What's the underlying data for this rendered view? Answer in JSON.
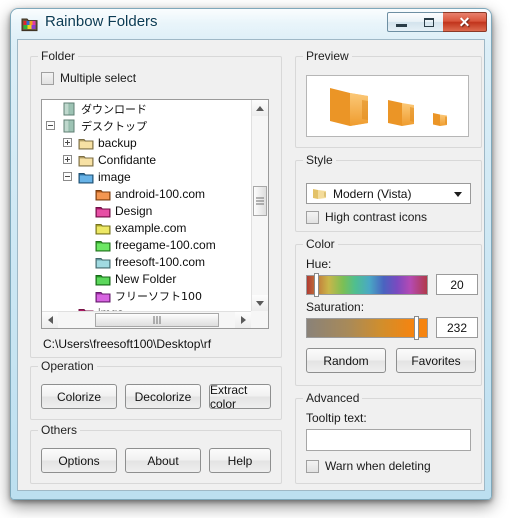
{
  "window": {
    "title": "Rainbow Folders",
    "icon": "rainbow-folder-icon",
    "minimize_label": "Minimize",
    "maximize_label": "Maximize",
    "close_label": "Close",
    "close_glyph": "✕"
  },
  "folder_group": {
    "legend": "Folder",
    "multiple_select_label": "Multiple select",
    "multiple_select_checked": false,
    "path": "C:\\Users\\freesoft100\\Desktop\\rf",
    "tree": [
      {
        "name": "ダウンロード",
        "depth": 2,
        "expander": "none",
        "icon": "special-folder-teal",
        "color": "#8fb8a8",
        "jp": true
      },
      {
        "name": "デスクトップ",
        "depth": 2,
        "expander": "minus",
        "icon": "special-folder-teal",
        "color": "#8fb8a8",
        "jp": true
      },
      {
        "name": "backup",
        "depth": 3,
        "expander": "plus",
        "icon": "folder-yellow",
        "color": "#f5d98a",
        "jp": false
      },
      {
        "name": "Confidante",
        "depth": 3,
        "expander": "plus",
        "icon": "folder-yellow",
        "color": "#f5d98a",
        "jp": false
      },
      {
        "name": "image",
        "depth": 3,
        "expander": "minus",
        "icon": "folder-blue",
        "color": "#3e9de0",
        "jp": false
      },
      {
        "name": "android-100.com",
        "depth": 4,
        "expander": "none",
        "icon": "folder-orange",
        "color": "#f07820",
        "jp": false
      },
      {
        "name": "Design",
        "depth": 4,
        "expander": "none",
        "icon": "folder-magenta",
        "color": "#e01f8b",
        "jp": false
      },
      {
        "name": "example.com",
        "depth": 4,
        "expander": "none",
        "icon": "folder-yellow-bright",
        "color": "#e8e23a",
        "jp": false
      },
      {
        "name": "freegame-100.com",
        "depth": 4,
        "expander": "none",
        "icon": "folder-green-bright",
        "color": "#44e038",
        "jp": false
      },
      {
        "name": "freesoft-100.com",
        "depth": 4,
        "expander": "none",
        "icon": "folder-cyan",
        "color": "#87cfd8",
        "jp": false
      },
      {
        "name": "New Folder",
        "depth": 4,
        "expander": "none",
        "icon": "folder-green",
        "color": "#2ecc2e",
        "jp": false
      },
      {
        "name": "フリーソフト100",
        "depth": 4,
        "expander": "none",
        "icon": "folder-purple",
        "color": "#cc39d8",
        "jp": true
      },
      {
        "name": "imgs",
        "depth": 3,
        "expander": "none",
        "icon": "folder-pink",
        "color": "#f0268c",
        "jp": false
      }
    ]
  },
  "operation_group": {
    "legend": "Operation",
    "buttons": [
      {
        "label": "Colorize"
      },
      {
        "label": "Decolorize"
      },
      {
        "label": "Extract color"
      }
    ]
  },
  "others_group": {
    "legend": "Others",
    "buttons": [
      {
        "label": "Options"
      },
      {
        "label": "About"
      },
      {
        "label": "Help"
      }
    ]
  },
  "preview_group": {
    "legend": "Preview",
    "folder_color": "#f5a030",
    "icons": [
      "preview-folder-large",
      "preview-folder-medium",
      "preview-folder-small"
    ]
  },
  "style_group": {
    "legend": "Style",
    "selected": "Modern (Vista)",
    "high_contrast_label": "High contrast icons",
    "high_contrast_checked": false
  },
  "color_group": {
    "legend": "Color",
    "hue_label": "Hue:",
    "hue_value": "20",
    "hue_percent": 7.8,
    "saturation_label": "Saturation:",
    "saturation_value": "232",
    "saturation_percent": 91.0,
    "sat_gradient_from": "#8a8278",
    "sat_gradient_to": "#f58410",
    "random_label": "Random",
    "favorites_label": "Favorites"
  },
  "advanced_group": {
    "legend": "Advanced",
    "tooltip_label": "Tooltip text:",
    "tooltip_value": "",
    "tooltip_placeholder": "",
    "warn_label": "Warn when deleting",
    "warn_checked": false
  }
}
